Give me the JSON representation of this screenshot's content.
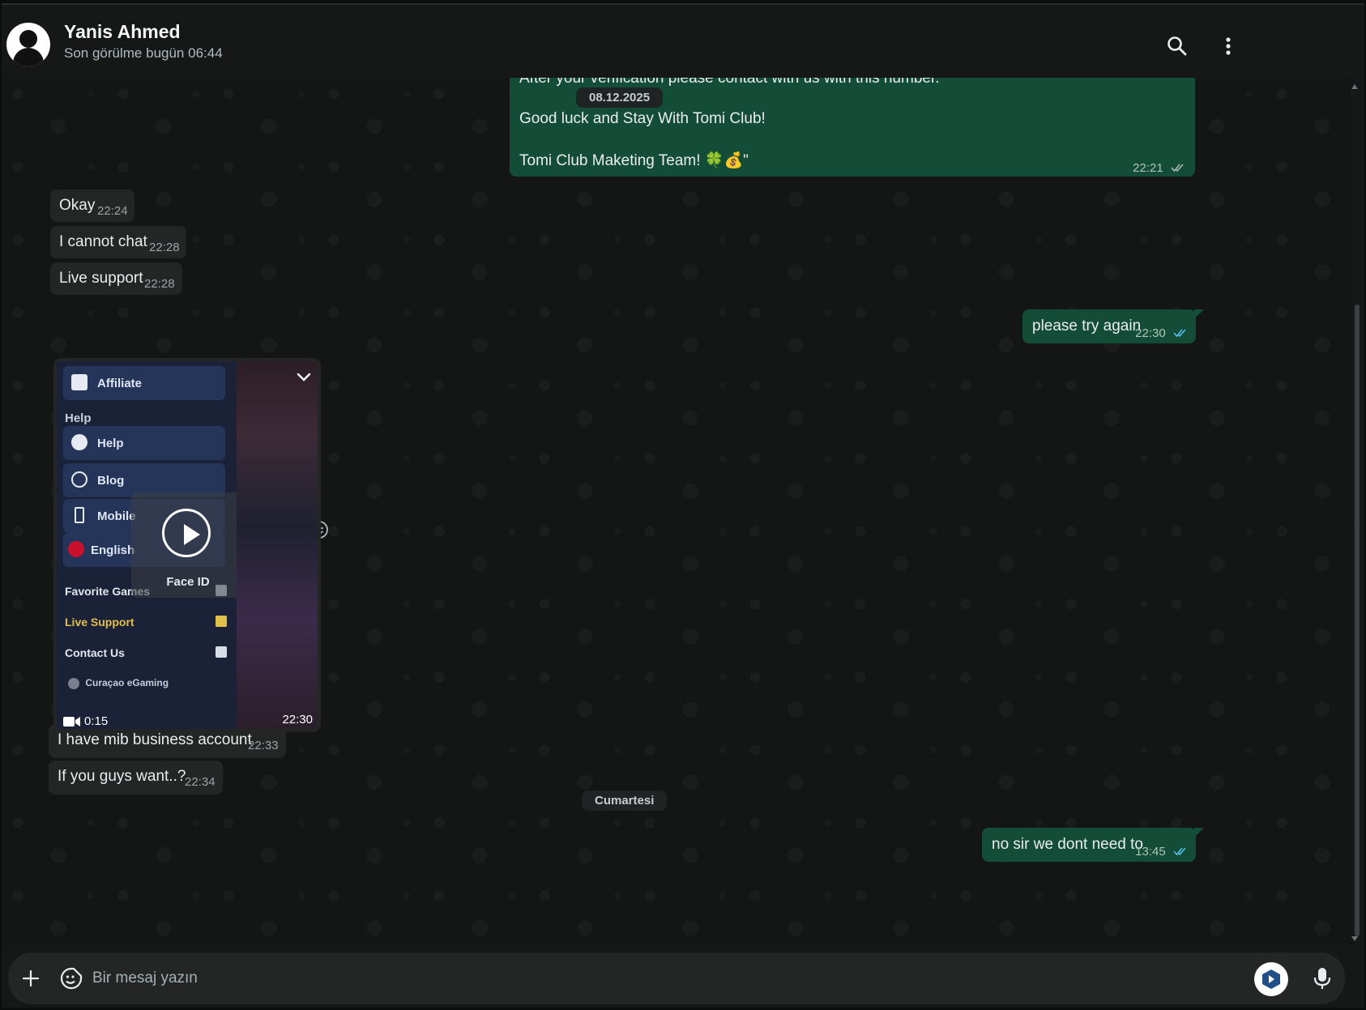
{
  "header": {
    "contact_name": "Yanis Ahmed",
    "status": "Son görülme bugün 06:44"
  },
  "messages": {
    "top_partial": {
      "line1": "After your verification please contact with us with this number.",
      "line2": "Good luck and Stay With Tomi Club!",
      "line3": "Tomi Club Maketing Team! 🍀💰\"",
      "time": "22:21"
    },
    "date_top": "08.12.2025",
    "in1": {
      "text": "Okay",
      "time": "22:24"
    },
    "in2": {
      "text": "I cannot chat",
      "time": "22:28"
    },
    "in3": {
      "text": "Live support",
      "time": "22:28"
    },
    "out1": {
      "text": "please try again",
      "time": "22:30"
    },
    "video": {
      "menu_affiliate": "Affiliate",
      "label_help": "Help",
      "menu_help": "Help",
      "menu_blog": "Blog",
      "menu_mobile": "Mobile",
      "menu_english": "English",
      "row_favorite": "Favorite Games",
      "row_live_support": "Live Support",
      "row_contact": "Contact Us",
      "row_curacao": "Curaçao eGaming",
      "overlay_label": "Face ID",
      "duration": "0:15",
      "time": "22:30"
    },
    "in4": {
      "text": "I have mib business account",
      "time": "22:33"
    },
    "in5": {
      "text": "If you guys want..?",
      "time": "22:34"
    },
    "date_bottom": "Cumartesi",
    "out2": {
      "text": "no sir we dont need to",
      "time": "13:45"
    }
  },
  "composer": {
    "placeholder": "Bir mesaj yazın"
  },
  "colors": {
    "outgoing_bubble": "#144d37",
    "incoming_bubble": "#242626",
    "read_ticks": "#53bdeb"
  }
}
